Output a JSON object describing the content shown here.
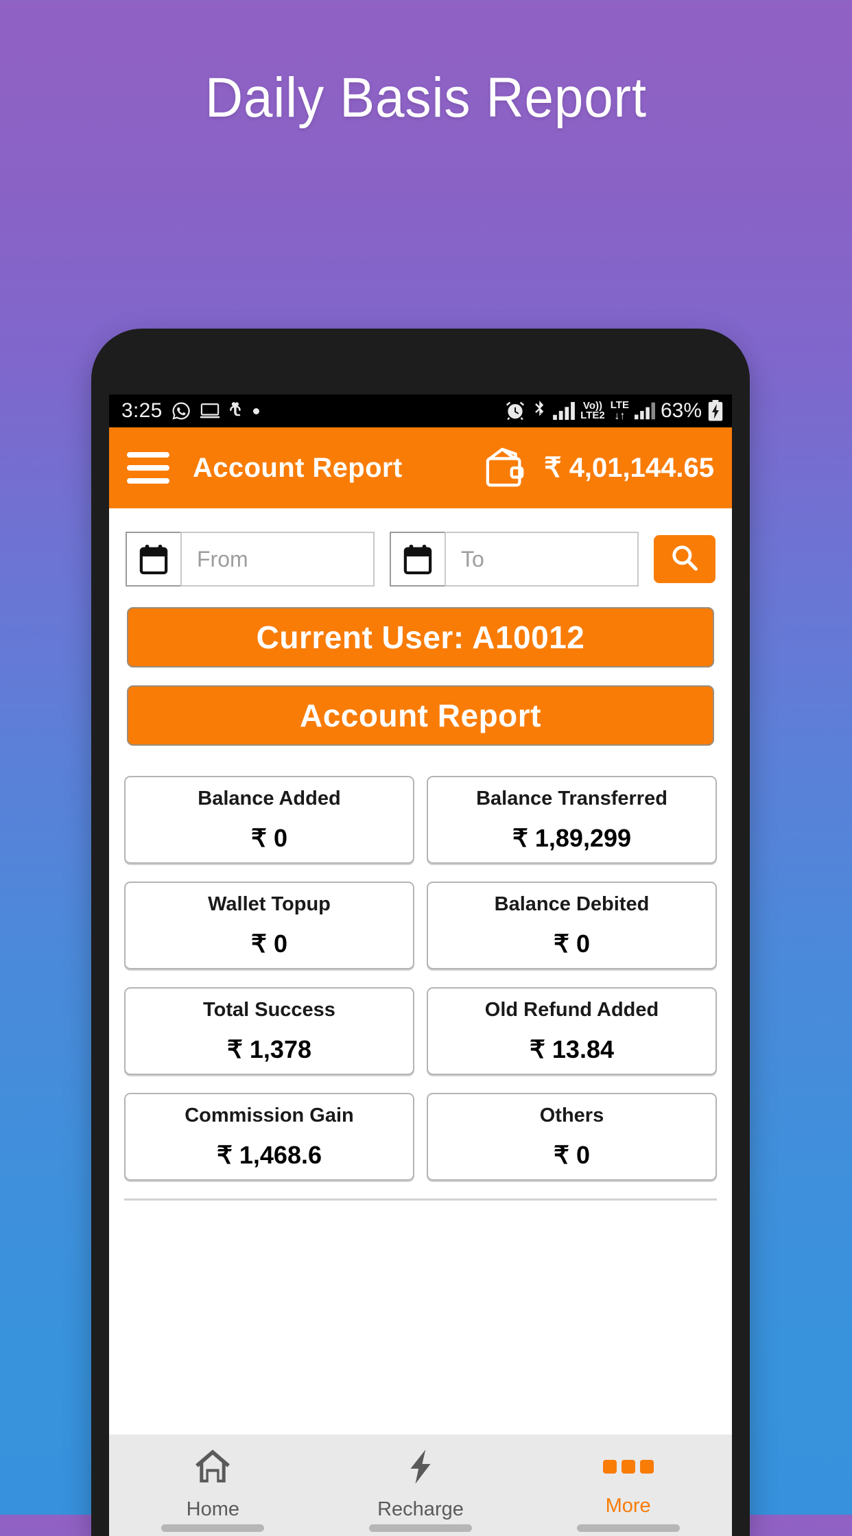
{
  "promo": {
    "title": "Daily Basis Report"
  },
  "status_bar": {
    "time": "3:25",
    "left_icons": [
      "whatsapp-icon",
      "screen-cast-icon",
      "download-manager-icon",
      "dot-icon"
    ],
    "right_icons": [
      "alarm-icon",
      "bluetooth-icon",
      "signal-bars-icon",
      "volte2-icon",
      "lte-data-icon",
      "signal-bars-2-icon"
    ],
    "network_primary": "Vo))",
    "network_primary_sub": "LTE2",
    "network_secondary": "LTE",
    "battery_percent": "63%"
  },
  "appbar": {
    "menu_icon": "hamburger-icon",
    "title": "Account Report",
    "wallet_icon": "wallet-icon",
    "wallet_balance": "₹ 4,01,144.65",
    "background": "#f97c07"
  },
  "filters": {
    "from": {
      "icon": "calendar-icon",
      "value": "",
      "placeholder": "From"
    },
    "to": {
      "icon": "calendar-icon",
      "value": "",
      "placeholder": "To"
    },
    "search_icon": "search-icon"
  },
  "buttons": {
    "current_user": "Current User: A10012",
    "account_report": "Account Report"
  },
  "stats": [
    [
      {
        "label": "Balance Added",
        "value": "₹ 0"
      },
      {
        "label": "Balance Transferred",
        "value": "₹ 1,89,299"
      }
    ],
    [
      {
        "label": "Wallet Topup",
        "value": "₹ 0"
      },
      {
        "label": "Balance Debited",
        "value": "₹ 0"
      }
    ],
    [
      {
        "label": "Total Success",
        "value": "₹ 1,378"
      },
      {
        "label": "Old Refund Added",
        "value": "₹ 13.84"
      }
    ],
    [
      {
        "label": "Commission Gain",
        "value": "₹ 1,468.6"
      },
      {
        "label": "Others",
        "value": "₹ 0"
      }
    ]
  ],
  "bottom_nav": [
    {
      "label": "Home",
      "icon": "home-icon",
      "active": false
    },
    {
      "label": "Recharge",
      "icon": "lightning-bolt-icon",
      "active": false
    },
    {
      "label": "More",
      "icon": "three-dots-icon",
      "active": true
    }
  ],
  "colors": {
    "accent": "#f97c07",
    "bg_top": "#9161c4",
    "bg_bottom": "#3791dc"
  }
}
